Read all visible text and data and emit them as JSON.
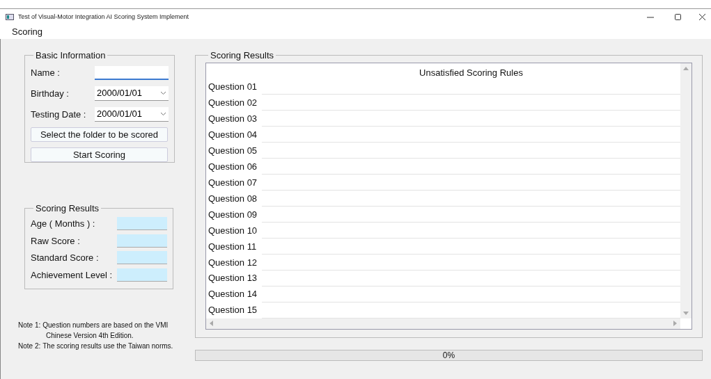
{
  "window": {
    "title": "Test of Visual-Motor Integration AI Scoring System Implement"
  },
  "menu": [
    "Scoring"
  ],
  "basic_info": {
    "title": "Basic Information",
    "fields": [
      {
        "kind": "text",
        "label": "Name :"
      },
      {
        "kind": "date",
        "label": "Birthday :",
        "value": "2000/01/01"
      },
      {
        "kind": "date",
        "label": "Testing Date :",
        "value": "2000/01/01"
      }
    ],
    "buttons": [
      "Select the folder to be scored",
      "Start Scoring"
    ]
  },
  "scoring_results": {
    "title": "Scoring Results",
    "fields": [
      "Age ( Months ) :",
      "Raw Score :",
      "Standard Score :",
      "Achievement Level :"
    ]
  },
  "notes": [
    {
      "label": "Note 1:",
      "text": "Question numbers are based on the VMI",
      "continuation": "Chinese Version 4th Edition."
    },
    {
      "label": "Note 2:",
      "text": "The scoring results use the Taiwan norms."
    }
  ],
  "results_panel": {
    "title": "Scoring Results",
    "column": "Unsatisfied Scoring Rules",
    "rows": [
      "Question 01",
      "Question 02",
      "Question 03",
      "Question 04",
      "Question 05",
      "Question 06",
      "Question 07",
      "Question 08",
      "Question 09",
      "Question 10",
      "Question 11",
      "Question 12",
      "Question 13",
      "Question 14",
      "Question 15"
    ]
  },
  "progress": {
    "level": 0,
    "text": "0%"
  }
}
